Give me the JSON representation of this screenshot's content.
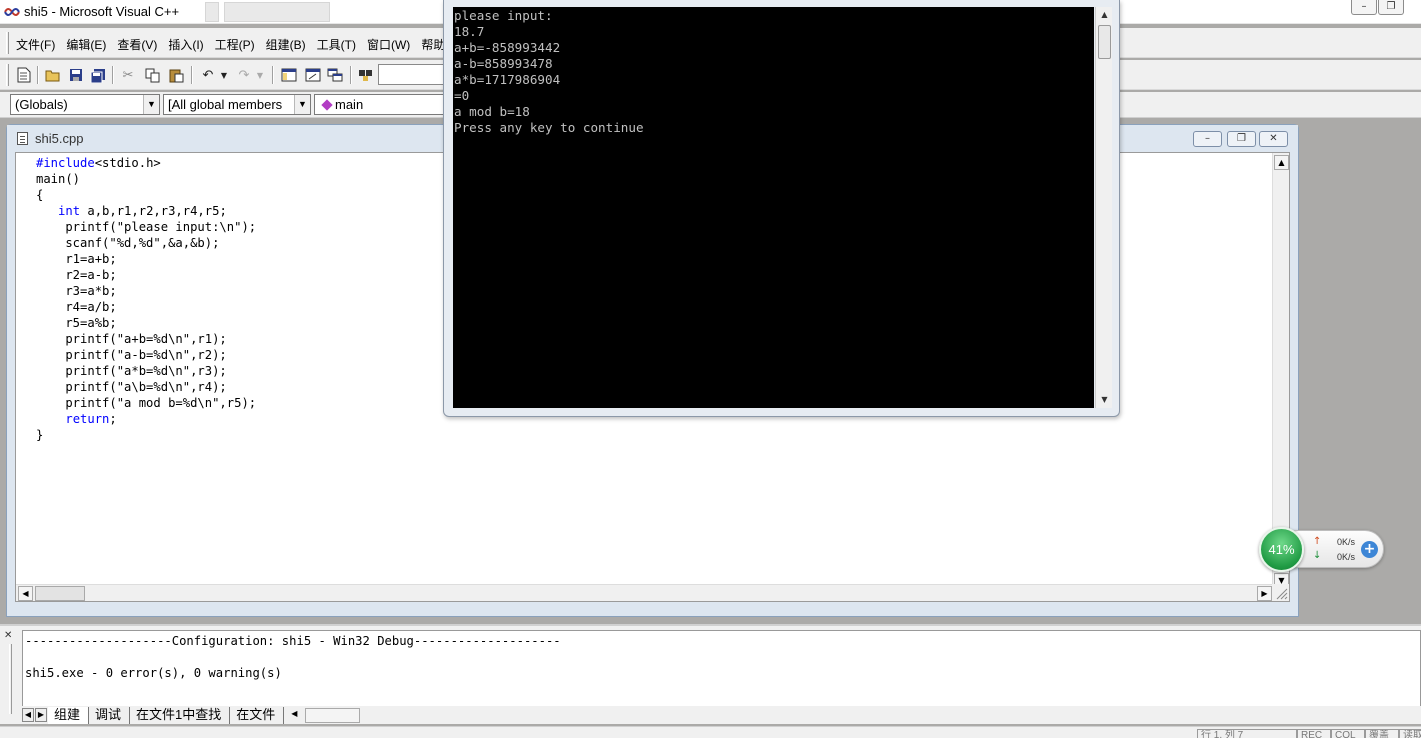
{
  "window": {
    "title": "shi5 - Microsoft Visual C++",
    "buttons": {
      "minimize": "–",
      "restore": "❐"
    }
  },
  "menu": [
    "文件(F)",
    "编辑(E)",
    "查看(V)",
    "插入(I)",
    "工程(P)",
    "组建(B)",
    "工具(T)",
    "窗口(W)",
    "帮助(H)"
  ],
  "toolbar": {
    "buttons": [
      "new-file",
      "open",
      "save",
      "save-all",
      "cut",
      "copy",
      "paste",
      "undo",
      "redo",
      "workspace",
      "output",
      "window-list",
      "find-in-files"
    ]
  },
  "wizardbar": {
    "scope": "(Globals)",
    "members": "[All global members",
    "function": "main"
  },
  "editor": {
    "title": "shi5.cpp",
    "buttons": {
      "minimize": "–",
      "restore": "❐",
      "close": "✕"
    },
    "code": [
      [
        {
          "t": "#include",
          "kw": true
        },
        {
          "t": "<stdio.h>"
        }
      ],
      [
        {
          "t": "main()"
        }
      ],
      [
        {
          "t": "{"
        }
      ],
      [
        {
          "t": "   "
        },
        {
          "t": "int",
          "kw": true
        },
        {
          "t": " a,b,r1,r2,r3,r4,r5;"
        }
      ],
      [
        {
          "t": "    printf(\"please input:\\n\");"
        }
      ],
      [
        {
          "t": "    scanf(\"%d,%d\",&a,&b);"
        }
      ],
      [
        {
          "t": "    r1=a+b;"
        }
      ],
      [
        {
          "t": "    r2=a-b;"
        }
      ],
      [
        {
          "t": "    r3=a*b;"
        }
      ],
      [
        {
          "t": "    r4=a/b;"
        }
      ],
      [
        {
          "t": "    r5=a%b;"
        }
      ],
      [
        {
          "t": "    printf(\"a+b=%d\\n\",r1);"
        }
      ],
      [
        {
          "t": "    printf(\"a-b=%d\\n\",r2);"
        }
      ],
      [
        {
          "t": "    printf(\"a*b=%d\\n\",r3);"
        }
      ],
      [
        {
          "t": "    printf(\"a\\b=%d\\n\",r4);"
        }
      ],
      [
        {
          "t": "    printf(\"a mod b=%d\\n\",r5);"
        }
      ],
      [
        {
          "t": "    "
        },
        {
          "t": "return",
          "kw": true
        },
        {
          "t": ";"
        }
      ],
      [
        {
          "t": "}"
        }
      ]
    ]
  },
  "console": {
    "lines": [
      "please input:",
      "18.7",
      "a+b=-858993442",
      "a-b=858993478",
      "a*b=1717986904",
      "=0",
      "a mod b=18",
      "Press any key to continue"
    ]
  },
  "output": {
    "lines": [
      "--------------------Configuration: shi5 - Win32 Debug--------------------",
      "",
      "shi5.exe - 0 error(s), 0 warning(s)"
    ],
    "tabs": [
      "组建",
      "调试",
      "在文件1中查找",
      "在文件"
    ]
  },
  "network": {
    "percent": "41%",
    "upload": "0K/s",
    "download": "0K/s"
  },
  "statusbar": {
    "position": "行 1, 列 7",
    "rec": "REC",
    "col": "COL",
    "ovr": "覆盖",
    "read": "读取"
  },
  "colors": {
    "keyword": "#0000ff",
    "console_bg": "#000000",
    "console_fg": "#c0c0c0"
  }
}
